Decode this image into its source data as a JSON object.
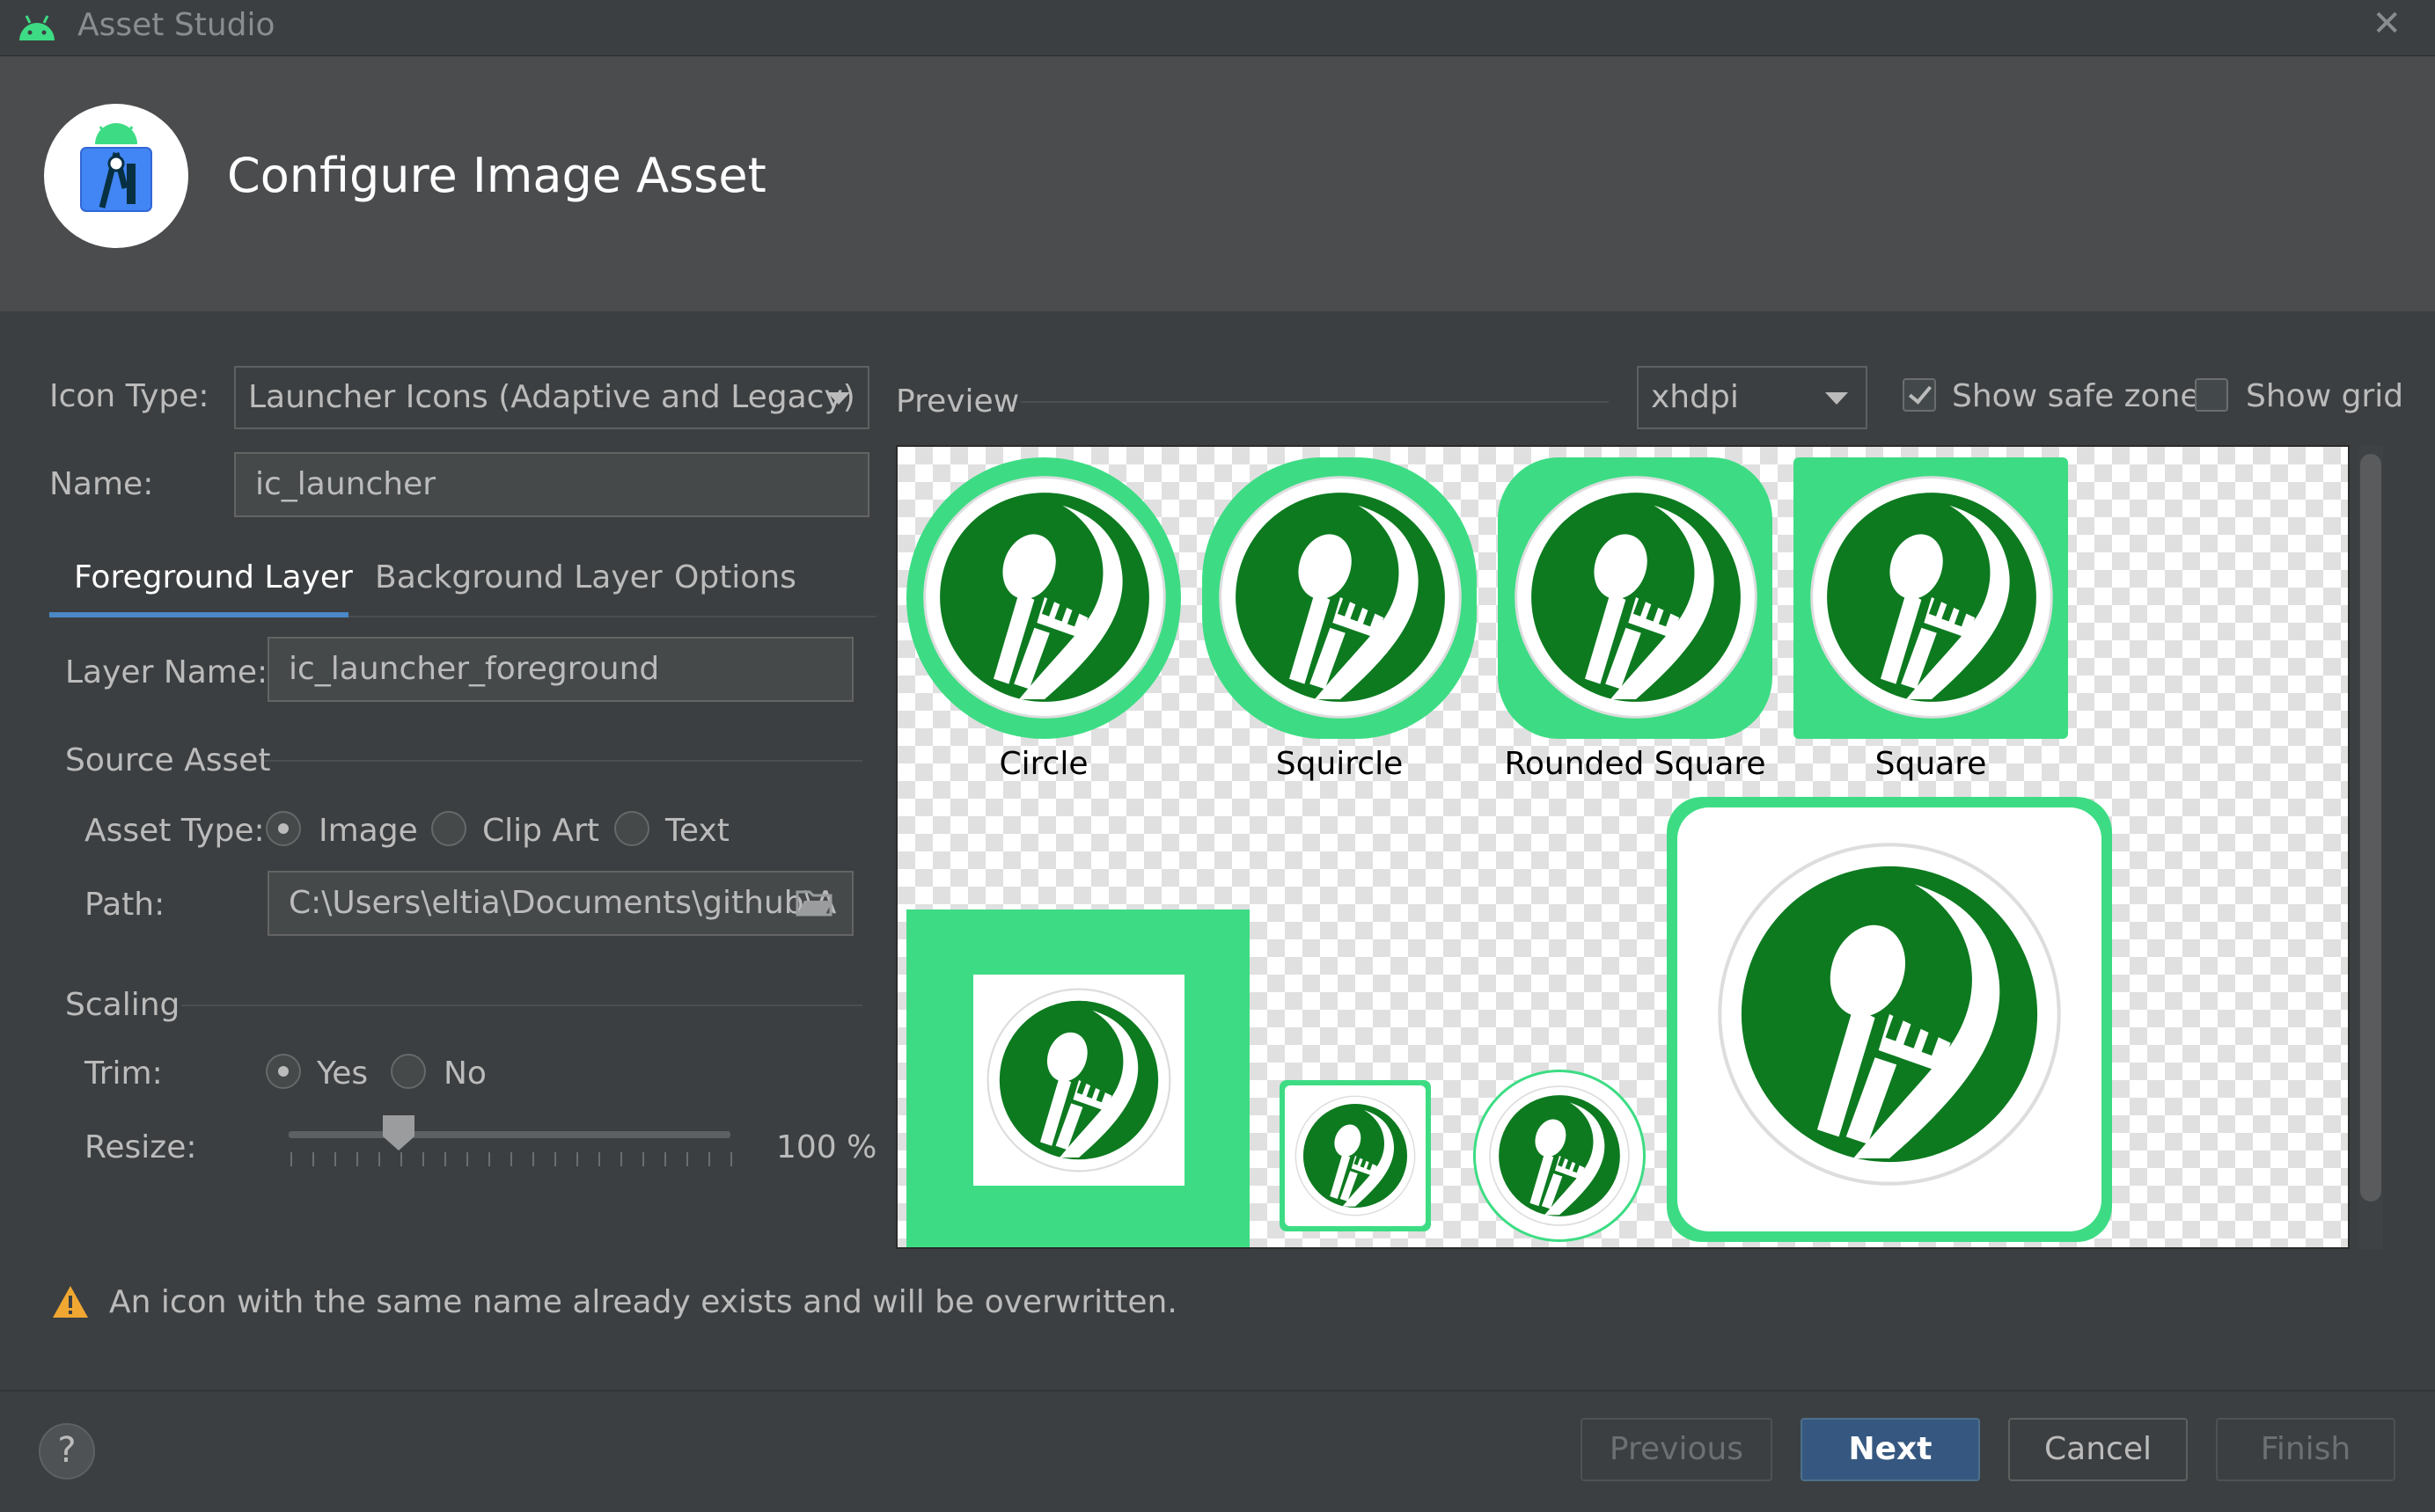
{
  "window": {
    "title": "Asset Studio",
    "close_glyph": "✕"
  },
  "header": {
    "title": "Configure Image Asset",
    "logo": "android-studio-logo"
  },
  "form": {
    "icon_type_label": "Icon Type:",
    "icon_type_value": "Launcher Icons (Adaptive and Legacy)",
    "name_label": "Name:",
    "name_value": "ic_launcher"
  },
  "tabs": [
    {
      "label": "Foreground Layer",
      "selected": true
    },
    {
      "label": "Background Layer",
      "selected": false
    },
    {
      "label": "Options",
      "selected": false
    }
  ],
  "layer": {
    "label": "Layer Name:",
    "value": "ic_launcher_foreground"
  },
  "source_asset": {
    "title": "Source Asset",
    "asset_type_label": "Asset Type:",
    "options": [
      {
        "label": "Image",
        "selected": true
      },
      {
        "label": "Clip Art",
        "selected": false
      },
      {
        "label": "Text",
        "selected": false
      }
    ],
    "path_label": "Path:",
    "path_value": "C:\\Users\\eltia\\Documents\\github\\A"
  },
  "scaling": {
    "title": "Scaling",
    "trim_label": "Trim:",
    "trim_options": [
      {
        "label": "Yes",
        "selected": true
      },
      {
        "label": "No",
        "selected": false
      }
    ],
    "resize_label": "Resize:",
    "resize_value": "100 %",
    "resize_fraction": 0.25
  },
  "preview": {
    "label": "Preview",
    "density": "xhdpi",
    "show_safe_zone_label": "Show safe zone",
    "show_safe_zone": true,
    "show_grid_label": "Show grid",
    "show_grid": false,
    "shape_labels": [
      "Circle",
      "Squircle",
      "Rounded Square",
      "Square"
    ],
    "accent": "#3ddc84",
    "icon_green": "#0d7a20"
  },
  "warning": {
    "text": "An icon with the same name already exists and will be overwritten.",
    "icon": "warning-icon"
  },
  "buttons": {
    "help": "?",
    "previous": "Previous",
    "next": "Next",
    "cancel": "Cancel",
    "finish": "Finish"
  }
}
